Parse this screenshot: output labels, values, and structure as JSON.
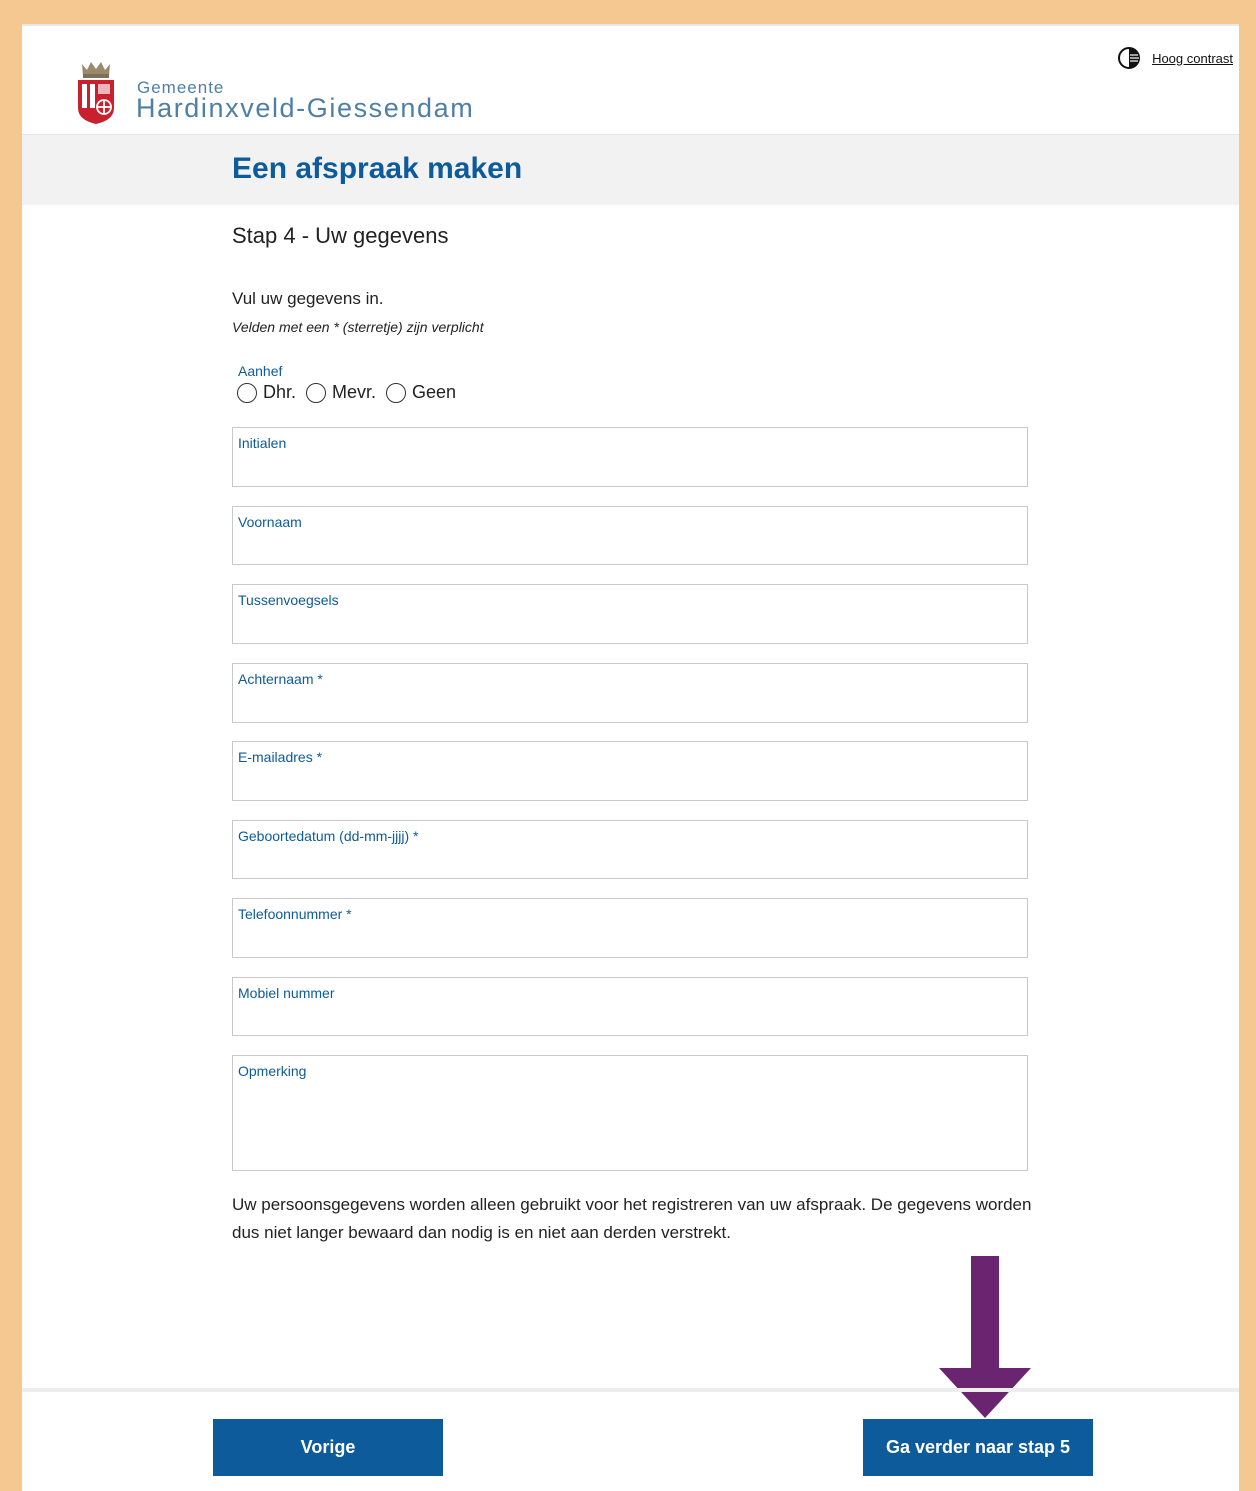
{
  "header": {
    "brand_small": "Gemeente",
    "brand_big": "Hardinxveld-Giessendam",
    "contrast_label": "Hoog contrast",
    "contrast_icon": "contrast-icon",
    "logo_icon": "coat-of-arms-icon"
  },
  "page": {
    "title": "Een afspraak maken",
    "step": "Stap 4 - Uw gegevens",
    "intro": "Vul uw gegevens in.",
    "note": "Velden met een * (sterretje) zijn verplicht"
  },
  "form": {
    "aanhef": {
      "label": "Aanhef",
      "options": [
        "Dhr.",
        "Mevr.",
        "Geen"
      ]
    },
    "fields": {
      "initialen": "Initialen",
      "voornaam": "Voornaam",
      "tussenvoegsels": "Tussenvoegsels",
      "achternaam": "Achternaam *",
      "email": "E-mailadres *",
      "geboortedatum": "Geboortedatum (dd-mm-jjjj) *",
      "telefoon": "Telefoonnummer *",
      "mobiel": "Mobiel nummer",
      "opmerking": "Opmerking"
    },
    "privacy": "Uw persoonsgegevens worden alleen gebruikt voor het registreren van uw afspraak. De gegevens worden dus niet langer bewaard dan nodig is en niet aan derden verstrekt."
  },
  "buttons": {
    "prev": "Vorige",
    "next": "Ga verder naar stap 5"
  },
  "colors": {
    "brand_blue": "#0d5b9a",
    "arrow_purple": "#6b2470",
    "frame_orange": "#f6c891"
  }
}
